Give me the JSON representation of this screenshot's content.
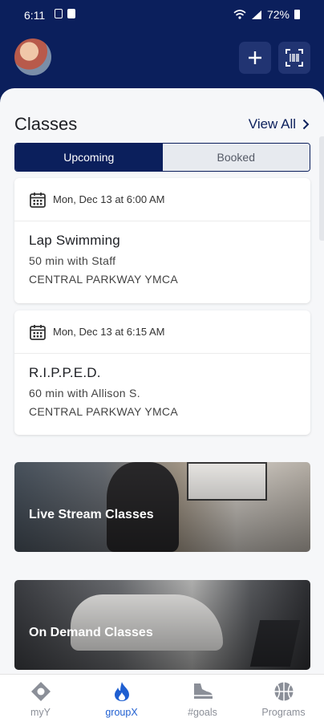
{
  "status_bar": {
    "time": "6:11",
    "battery": "72%"
  },
  "header": {
    "avatar_icon": "user-avatar",
    "add_icon": "plus-icon",
    "scan_icon": "barcode-scan-icon"
  },
  "classes": {
    "title": "Classes",
    "view_all_label": "View All",
    "tabs": [
      {
        "label": "Upcoming",
        "active": true
      },
      {
        "label": "Booked",
        "active": false
      }
    ],
    "items": [
      {
        "date": "Mon, Dec 13 at 6:00 AM",
        "name": "Lap Swimming",
        "detail": "50 min with Staff",
        "location": "CENTRAL PARKWAY YMCA"
      },
      {
        "date": "Mon, Dec 13 at 6:15 AM",
        "name": "R.I.P.P.E.D.",
        "detail": "60 min with Allison S.",
        "location": "CENTRAL PARKWAY YMCA"
      }
    ]
  },
  "banners": {
    "live_label": "Live Stream Classes",
    "demand_label": "On Demand Classes"
  },
  "nav": [
    {
      "label": "myY",
      "icon": "ymca-diamond-icon",
      "active": false
    },
    {
      "label": "groupX",
      "icon": "flame-icon",
      "active": true
    },
    {
      "label": "#goals",
      "icon": "shoe-icon",
      "active": false
    },
    {
      "label": "Programs",
      "icon": "basketball-icon",
      "active": false
    }
  ],
  "colors": {
    "brand_navy": "#0b1f5c",
    "active_nav": "#1f5fd1"
  }
}
